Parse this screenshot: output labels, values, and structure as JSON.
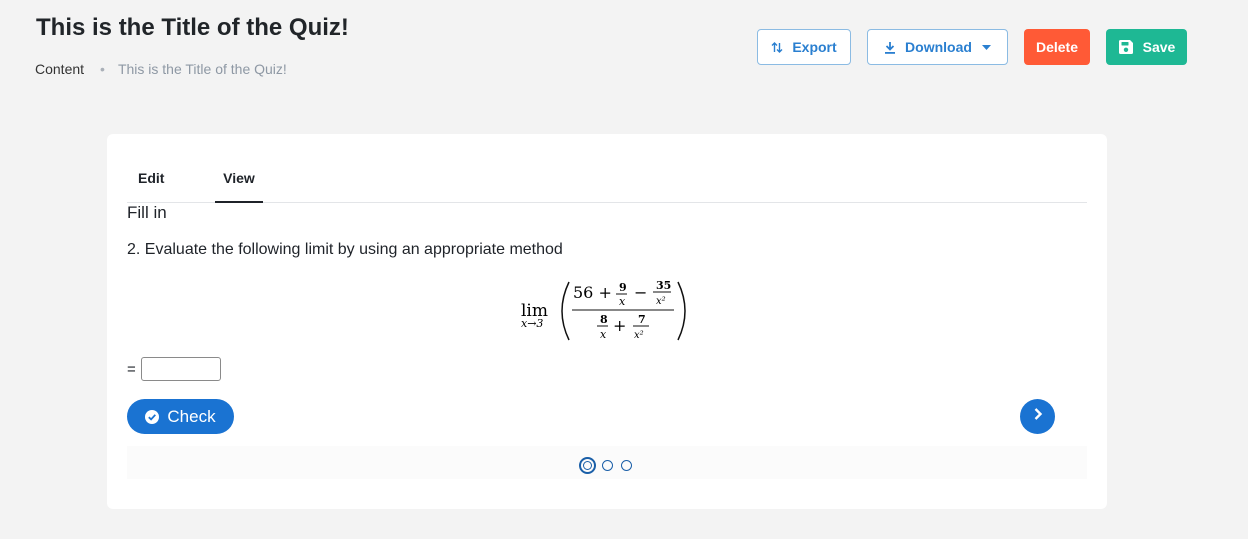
{
  "header": {
    "title": "This is the Title of the Quiz!",
    "breadcrumb": {
      "root": "Content",
      "separator": "•",
      "current": "This is the Title of the Quiz!"
    }
  },
  "toolbar": {
    "export_label": "Export",
    "download_label": "Download",
    "delete_label": "Delete",
    "save_label": "Save"
  },
  "tabs": [
    {
      "label": "Edit",
      "active": false
    },
    {
      "label": "View",
      "active": true
    }
  ],
  "quiz": {
    "type_heading": "Fill in",
    "question": "2. Evaluate the following limit by using an appropriate method",
    "formula": {
      "operator": "lim",
      "subscript": "x→3",
      "numerator_text": "56 +",
      "minus": "−",
      "plus": "+",
      "num_frac1": {
        "numerator": "9",
        "denominator": "x"
      },
      "num_frac2": {
        "numerator": "35",
        "denominator": "x²"
      },
      "den_frac1": {
        "numerator": "8",
        "denominator": "x"
      },
      "den_frac2": {
        "numerator": "7",
        "denominator": "x²"
      }
    },
    "answer_prefix": "=",
    "answer_value": "",
    "check_label": "Check"
  },
  "pagination": {
    "total": 3,
    "current": 1
  },
  "colors": {
    "accent": "#1a73d2",
    "delete": "#ff5a36",
    "save": "#1eb894",
    "outline": "#2a7fd0"
  },
  "icons": {
    "export": "sort-arrows-icon",
    "download": "download-icon",
    "dropdown": "caret-down-icon",
    "save": "floppy-disk-icon",
    "check": "check-circle-icon",
    "next": "chevron-right-icon"
  }
}
